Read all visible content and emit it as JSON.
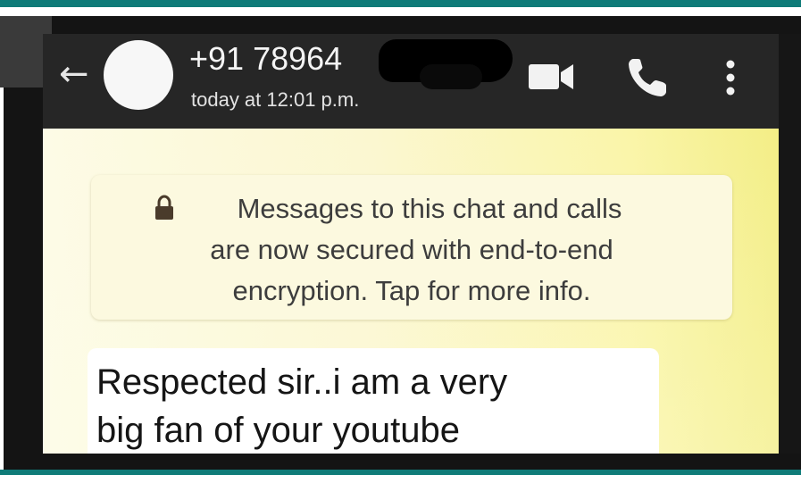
{
  "header": {
    "back_icon": "back-arrow-icon",
    "avatar_icon": "avatar",
    "contact_name": "+91 78964",
    "last_seen": "today at 12:01 p.m.",
    "actions": [
      {
        "icon": "video-call-icon"
      },
      {
        "icon": "phone-call-icon"
      },
      {
        "icon": "more-options-icon"
      }
    ]
  },
  "chat": {
    "system_notice": {
      "icon": "lock-icon",
      "lines": [
        "Messages to this chat and calls",
        "are now secured with end-to-end",
        "encryption. Tap for more info."
      ]
    },
    "message": {
      "lines": [
        "Respected sir..i am a very",
        "big fan of your youtube"
      ]
    }
  },
  "colors": {
    "header_bg": "#262626",
    "frame_accent": "#0f7b78",
    "chat_bg": "#fbf7d0",
    "bubble_bg": "#ffffff"
  }
}
